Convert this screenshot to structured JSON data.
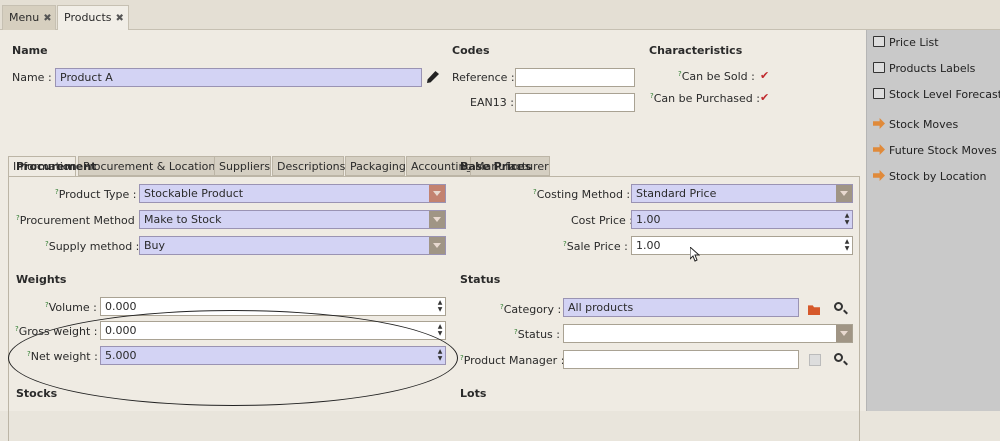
{
  "window_tabs": [
    {
      "label": "Menu"
    },
    {
      "label": "Products"
    }
  ],
  "header": {
    "name_section": "Name",
    "name_label": "Name :",
    "name_value": "Product A",
    "codes_section": "Codes",
    "reference_label": "Reference :",
    "reference_value": "",
    "ean13_label": "EAN13 :",
    "ean13_value": "",
    "characteristics_section": "Characteristics",
    "can_be_sold_label": "Can be Sold :",
    "can_be_sold": true,
    "can_be_purchased_label": "Can be Purchased :",
    "can_be_purchased": true
  },
  "form_tabs": [
    "Information",
    "Procurement & Locations",
    "Suppliers",
    "Descriptions",
    "Packaging",
    "Accounting",
    "Manufacturer"
  ],
  "procurement": {
    "title": "Procurement",
    "product_type_label": "Product Type :",
    "product_type_value": "Stockable Product",
    "procurement_method_label": "Procurement Method :",
    "procurement_method_value": "Make to Stock",
    "supply_method_label": "Supply method :",
    "supply_method_value": "Buy"
  },
  "base_prices": {
    "title": "Base Prices",
    "costing_method_label": "Costing Method :",
    "costing_method_value": "Standard Price",
    "cost_price_label": "Cost Price :",
    "cost_price_value": "1.00",
    "sale_price_label": "Sale Price :",
    "sale_price_value": "1.00"
  },
  "weights": {
    "title": "Weights",
    "volume_label": "Volume :",
    "volume_value": "0.000",
    "gross_weight_label": "Gross weight :",
    "gross_weight_value": "0.000",
    "net_weight_label": "Net weight :",
    "net_weight_value": "5.000"
  },
  "status": {
    "title": "Status",
    "category_label": "Category :",
    "category_value": "All products",
    "status_label": "Status :",
    "status_value": "",
    "product_manager_label": "Product Manager :",
    "product_manager_value": ""
  },
  "bottom": {
    "stocks_title": "Stocks",
    "lots_title": "Lots"
  },
  "help_marker": "?",
  "sidebar": {
    "items": [
      {
        "label": "Price List",
        "icon": "print-icon"
      },
      {
        "label": "Products Labels",
        "icon": "print-icon"
      },
      {
        "label": "Stock Level Forecast",
        "icon": "print-icon"
      },
      {
        "label": "Stock Moves",
        "icon": "arrow-icon"
      },
      {
        "label": "Future Stock Moves",
        "icon": "arrow-icon"
      },
      {
        "label": "Stock by Location",
        "icon": "arrow-icon"
      }
    ]
  },
  "colors": {
    "required_field": "#d3d3f4",
    "checkbox": "#c0282c",
    "sidebar_bg": "#c9c9c9",
    "form_bg": "#efebe3"
  }
}
